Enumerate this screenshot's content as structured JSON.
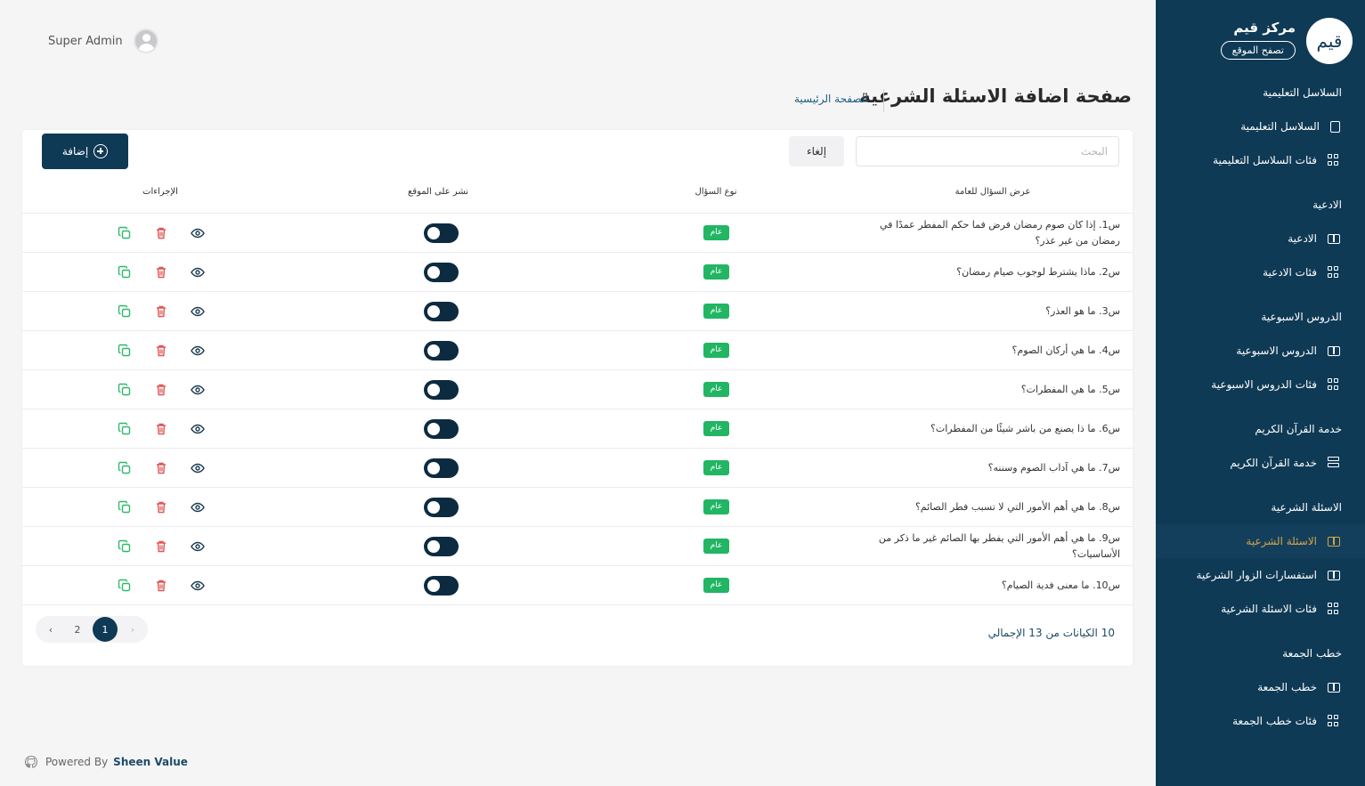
{
  "header": {
    "user_name": "Super Admin",
    "page_title": "صفحة اضافة الاسئلة الشرعية",
    "breadcrumb": "الصفحة الرئيسية"
  },
  "sidebar": {
    "brand_name": "مركز قيم",
    "logo_text": "قيم",
    "browse_label": "تصفح الموقع",
    "sections": [
      {
        "title": "السلاسل التعليمية",
        "items": [
          {
            "label": "السلاسل التعليمية",
            "icon": "document-icon",
            "active": false
          },
          {
            "label": "فئات السلاسل التعليمية",
            "icon": "grid-icon",
            "active": false
          }
        ]
      },
      {
        "title": "الادعية",
        "items": [
          {
            "label": "الادعية",
            "icon": "book-icon",
            "active": false
          },
          {
            "label": "فئات الادعية",
            "icon": "grid-icon",
            "active": false
          }
        ]
      },
      {
        "title": "الدروس الاسبوعية",
        "items": [
          {
            "label": "الدروس الاسبوعية",
            "icon": "book-icon",
            "active": false
          },
          {
            "label": "فئات الدروس الاسبوعية",
            "icon": "grid-icon",
            "active": false
          }
        ]
      },
      {
        "title": "خدمة القرآن الكريم",
        "items": [
          {
            "label": "خدمة القرآن الكريم",
            "icon": "server-icon",
            "active": false
          }
        ]
      },
      {
        "title": "الاسئلة الشرعية",
        "items": [
          {
            "label": "الاسئلة الشرعية",
            "icon": "book-icon",
            "active": true
          },
          {
            "label": "استفسارات الزوار الشرعية",
            "icon": "book-icon",
            "active": false
          },
          {
            "label": "فئات الاسئلة الشرعية",
            "icon": "grid-icon",
            "active": false
          }
        ]
      },
      {
        "title": "خطب الجمعة",
        "items": [
          {
            "label": "خطب الجمعة",
            "icon": "book-icon",
            "active": false
          },
          {
            "label": "فئات خطب الجمعة",
            "icon": "grid-icon",
            "active": false
          }
        ]
      }
    ]
  },
  "toolbar": {
    "search_placeholder": "البحث",
    "cancel_label": "إلغاء",
    "add_label": "إضافة"
  },
  "table": {
    "columns": {
      "question": "عرض السؤال للعامة",
      "type": "نوع السؤال",
      "publish": "نشر على الموقع",
      "actions": "الإجراءات"
    },
    "rows": [
      {
        "question": "س1. إذا كان صوم رمضان فرض فما حكم المفطر عمدًا في رمضان من غير عذر؟",
        "type": "عام",
        "published": false
      },
      {
        "question": "س2. ماذا يشترط لوجوب صيام رمضان؟",
        "type": "عام",
        "published": false
      },
      {
        "question": "س3. ما هو العذر؟",
        "type": "عام",
        "published": false
      },
      {
        "question": "س4. ما هي أركان الصوم؟",
        "type": "عام",
        "published": false
      },
      {
        "question": "س5. ما هي المفطرات؟",
        "type": "عام",
        "published": false
      },
      {
        "question": "س6. ما ذا يصنع من باشر شيئًا من المفطرات؟",
        "type": "عام",
        "published": false
      },
      {
        "question": "س7. ما هي آداب الصوم وسننه؟",
        "type": "عام",
        "published": false
      },
      {
        "question": "س8. ما هي أهم الأمور التي لا تسبب فطر الصائم؟",
        "type": "عام",
        "published": false
      },
      {
        "question": "س9. ما هي أهم الأمور التي يفطر بها الصائم غير ما ذكر من الأساسيات؟",
        "type": "عام",
        "published": false
      },
      {
        "question": "س10. ما معنى فدية الصيام؟",
        "type": "عام",
        "published": false
      }
    ]
  },
  "pagination": {
    "total_text": "10 الكيانات من 13 الإجمالي",
    "prev": "‹",
    "next": "›",
    "pages": [
      "1",
      "2"
    ],
    "current": "1"
  },
  "footer": {
    "powered_by": "Powered By",
    "company": "Sheen Value"
  }
}
